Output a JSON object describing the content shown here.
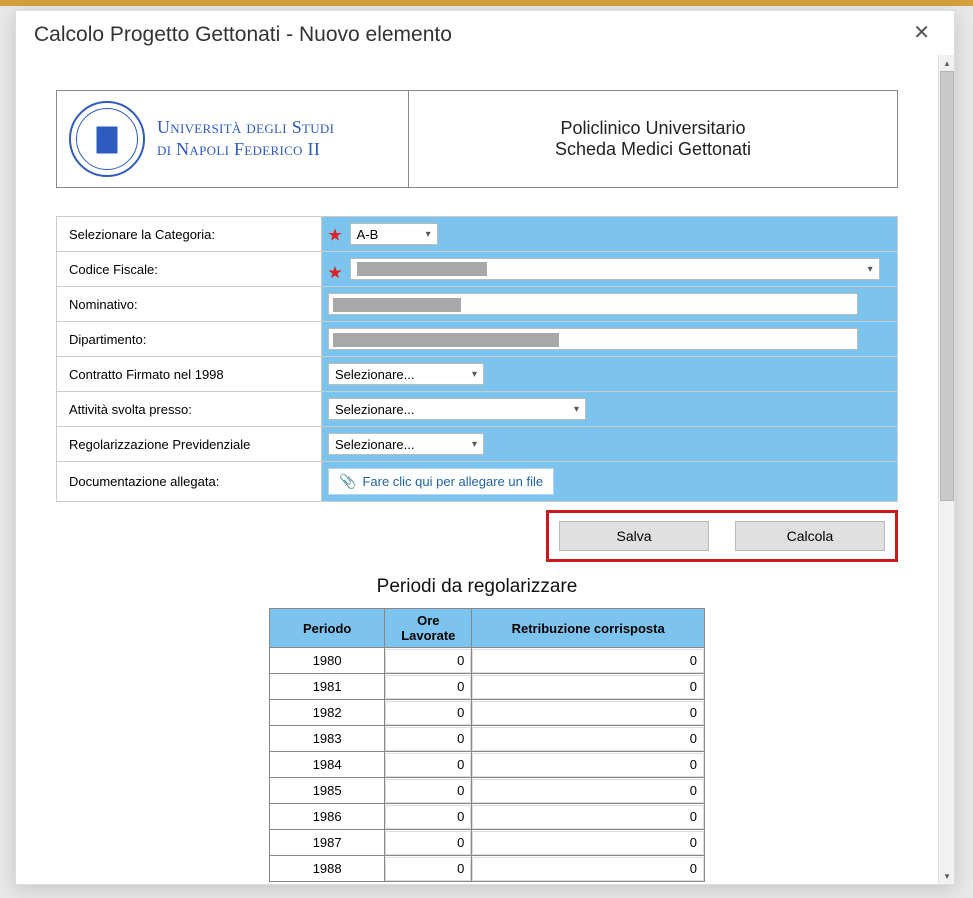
{
  "modal": {
    "title": "Calcolo Progetto Gettonati - Nuovo elemento"
  },
  "docHeader": {
    "uniLine1": "Università degli Studi",
    "uniLine2": "di Napoli Federico II",
    "rightLine1": "Policlinico Universitario",
    "rightLine2": "Scheda Medici Gettonati"
  },
  "form": {
    "categoria": {
      "label": "Selezionare la Categoria:",
      "value": "A-B"
    },
    "codiceFiscale": {
      "label": "Codice Fiscale:"
    },
    "nominativo": {
      "label": "Nominativo:"
    },
    "dipartimento": {
      "label": "Dipartimento:"
    },
    "contratto": {
      "label": "Contratto Firmato nel 1998",
      "value": "Selezionare..."
    },
    "attivita": {
      "label": "Attività svolta presso:",
      "value": "Selezionare..."
    },
    "regolarizzazione": {
      "label": "Regolarizzazione Previdenziale",
      "value": "Selezionare..."
    },
    "documentazione": {
      "label": "Documentazione allegata:",
      "attachText": "Fare clic qui per allegare un file"
    }
  },
  "buttons": {
    "salva": "Salva",
    "calcola": "Calcola"
  },
  "periodi": {
    "title": "Periodi da regolarizzare",
    "headers": {
      "periodo": "Periodo",
      "ore": "Ore Lavorate",
      "retrib": "Retribuzione corrisposta"
    },
    "rows": [
      {
        "year": "1980",
        "ore": "0",
        "retrib": "0"
      },
      {
        "year": "1981",
        "ore": "0",
        "retrib": "0"
      },
      {
        "year": "1982",
        "ore": "0",
        "retrib": "0"
      },
      {
        "year": "1983",
        "ore": "0",
        "retrib": "0"
      },
      {
        "year": "1984",
        "ore": "0",
        "retrib": "0"
      },
      {
        "year": "1985",
        "ore": "0",
        "retrib": "0"
      },
      {
        "year": "1986",
        "ore": "0",
        "retrib": "0"
      },
      {
        "year": "1987",
        "ore": "0",
        "retrib": "0"
      },
      {
        "year": "1988",
        "ore": "0",
        "retrib": "0"
      }
    ]
  }
}
